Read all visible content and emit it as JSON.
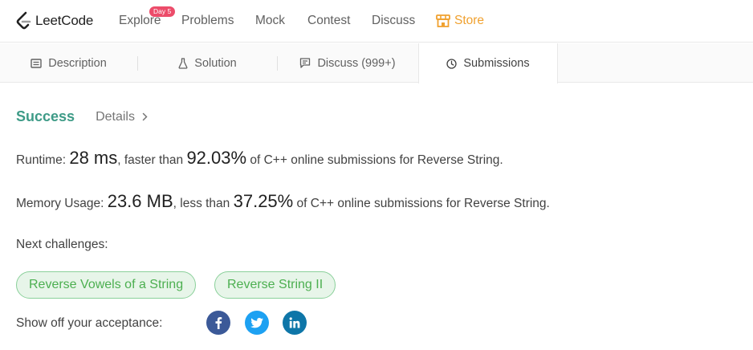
{
  "brand": {
    "name": "LeetCode"
  },
  "nav": {
    "items": [
      {
        "label": "Explore",
        "badge": "Day 5"
      },
      {
        "label": "Problems"
      },
      {
        "label": "Mock"
      },
      {
        "label": "Contest"
      },
      {
        "label": "Discuss"
      },
      {
        "label": "Store",
        "icon": "store-icon"
      }
    ]
  },
  "tabs": [
    {
      "label": "Description",
      "icon": "description-icon"
    },
    {
      "label": "Solution",
      "icon": "flask-icon"
    },
    {
      "label": "Discuss (999+)",
      "icon": "chat-icon"
    },
    {
      "label": "Submissions",
      "icon": "clock-icon",
      "active": true
    }
  ],
  "result": {
    "status": "Success",
    "details_label": "Details",
    "runtime": {
      "label": "Runtime: ",
      "value": "28 ms",
      "connector": ", faster than ",
      "percent": "92.03%",
      "suffix": " of C++ online submissions for Reverse String."
    },
    "memory": {
      "label": "Memory Usage: ",
      "value": "23.6 MB",
      "connector": ", less than ",
      "percent": "37.25%",
      "suffix": " of C++ online submissions for Reverse String."
    }
  },
  "next_challenges": {
    "label": "Next challenges:",
    "items": [
      "Reverse Vowels of a String",
      "Reverse String II"
    ]
  },
  "share": {
    "label": "Show off your acceptance:",
    "networks": [
      "facebook-icon",
      "twitter-icon",
      "linkedin-icon"
    ]
  },
  "colors": {
    "success": "#3e9b87",
    "store": "#f0a12f",
    "badge": "#ec4c6a",
    "challenge_bg": "#e7f5e9",
    "challenge_text": "#4caf50",
    "facebook": "#3b5998",
    "twitter": "#1da1f2",
    "linkedin": "#0e76a8"
  }
}
